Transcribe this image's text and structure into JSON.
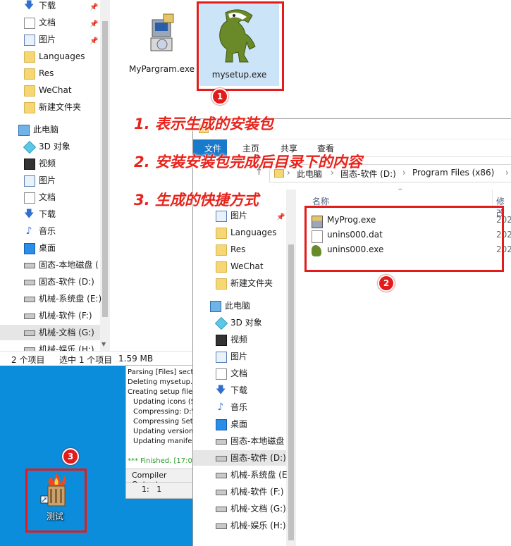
{
  "back_window": {
    "nav": [
      {
        "label": "下载",
        "icon": "download-icon",
        "pinned": true
      },
      {
        "label": "文档",
        "icon": "document-icon",
        "pinned": true
      },
      {
        "label": "图片",
        "icon": "picture-icon",
        "pinned": true
      },
      {
        "label": "Languages",
        "icon": "folder-icon",
        "pinned": false
      },
      {
        "label": "Res",
        "icon": "folder-icon",
        "pinned": false
      },
      {
        "label": "WeChat",
        "icon": "folder-icon",
        "pinned": false
      },
      {
        "label": "新建文件夹",
        "icon": "folder-icon",
        "pinned": false
      },
      {
        "label": "此电脑",
        "icon": "computer-icon",
        "pinned": false
      },
      {
        "label": "3D 对象",
        "icon": "3d-objects-icon",
        "pinned": false
      },
      {
        "label": "视频",
        "icon": "video-icon",
        "pinned": false
      },
      {
        "label": "图片",
        "icon": "picture-icon",
        "pinned": false
      },
      {
        "label": "文档",
        "icon": "document-icon",
        "pinned": false
      },
      {
        "label": "下载",
        "icon": "download-icon",
        "pinned": false
      },
      {
        "label": "音乐",
        "icon": "music-icon",
        "pinned": false
      },
      {
        "label": "桌面",
        "icon": "desktop-icon",
        "pinned": false
      },
      {
        "label": "固态-本地磁盘 (",
        "icon": "drive-icon",
        "pinned": false
      },
      {
        "label": "固态-软件 (D:)",
        "icon": "drive-icon",
        "pinned": false
      },
      {
        "label": "机械-系统盘 (E:)",
        "icon": "drive-icon",
        "pinned": false
      },
      {
        "label": "机械-软件 (F:)",
        "icon": "drive-icon",
        "pinned": false
      },
      {
        "label": "机械-文档 (G:)",
        "icon": "drive-icon",
        "pinned": false,
        "selected": true
      },
      {
        "label": "机械-娱乐 (H:)",
        "icon": "drive-icon",
        "pinned": false
      }
    ],
    "files": [
      {
        "name": "MyPargram.exe",
        "icon": "installer-icon"
      },
      {
        "name": "mysetup.exe",
        "icon": "dinosaur-icon"
      }
    ],
    "status": {
      "count": "2 个项目",
      "selected": "选中 1 个项目",
      "size": "1.59 MB"
    }
  },
  "annotations": {
    "line1": "1. 表示生成的安装包",
    "line2": "2. 安装安装包完成后目录下的内容",
    "line3": "3. 生成的快捷方式",
    "badge1": "1",
    "badge2": "2",
    "badge3": "3"
  },
  "compiler": {
    "lines": [
      {
        "text": "Parsing [Files] secti",
        "indent": false
      },
      {
        "text": "Deleting mysetup.ex",
        "indent": false
      },
      {
        "text": "Creating setup files",
        "indent": false
      },
      {
        "text": "Updating icons (SE",
        "indent": true
      },
      {
        "text": "Compressing: D:\\",
        "indent": true
      },
      {
        "text": "Compressing Setu",
        "indent": true
      },
      {
        "text": "Updating version",
        "indent": true
      },
      {
        "text": "Updating manifest",
        "indent": true
      }
    ],
    "finished": "*** Finished.  [17:0",
    "tab": "Compiler Output",
    "position": "1:   1"
  },
  "front_window": {
    "tabs": [
      "文件",
      "主页",
      "共享",
      "查看"
    ],
    "breadcrumb": [
      "此电脑",
      "固态-软件 (D:)",
      "Program Files (x86)"
    ],
    "col_name": "名称",
    "col_modified": "修改",
    "nav": [
      {
        "label": "图片",
        "icon": "picture-icon"
      },
      {
        "label": "Languages",
        "icon": "folder-icon"
      },
      {
        "label": "Res",
        "icon": "folder-icon"
      },
      {
        "label": "WeChat",
        "icon": "folder-icon"
      },
      {
        "label": "新建文件夹",
        "icon": "folder-icon"
      },
      {
        "label": "此电脑",
        "icon": "computer-icon"
      },
      {
        "label": "3D 对象",
        "icon": "3d-objects-icon"
      },
      {
        "label": "视频",
        "icon": "video-icon"
      },
      {
        "label": "图片",
        "icon": "picture-icon"
      },
      {
        "label": "文档",
        "icon": "document-icon"
      },
      {
        "label": "下载",
        "icon": "download-icon"
      },
      {
        "label": "音乐",
        "icon": "music-icon"
      },
      {
        "label": "桌面",
        "icon": "desktop-icon"
      },
      {
        "label": "固态-本地磁盘",
        "icon": "drive-icon"
      },
      {
        "label": "固态-软件 (D:)",
        "icon": "drive-icon",
        "selected": true
      },
      {
        "label": "机械-系统盘 (E",
        "icon": "drive-icon"
      },
      {
        "label": "机械-软件 (F:)",
        "icon": "drive-icon"
      },
      {
        "label": "机械-文档 (G:)",
        "icon": "drive-icon"
      },
      {
        "label": "机械-娱乐 (H:)",
        "icon": "drive-icon"
      }
    ],
    "files": [
      {
        "name": "MyProg.exe",
        "date": "202",
        "icon": "installer-icon"
      },
      {
        "name": "unins000.dat",
        "date": "202",
        "icon": "file-icon"
      },
      {
        "name": "unins000.exe",
        "date": "202",
        "icon": "dinosaur-icon"
      }
    ]
  },
  "shortcut": {
    "label": "测试",
    "icon": "fire-tower-icon"
  }
}
